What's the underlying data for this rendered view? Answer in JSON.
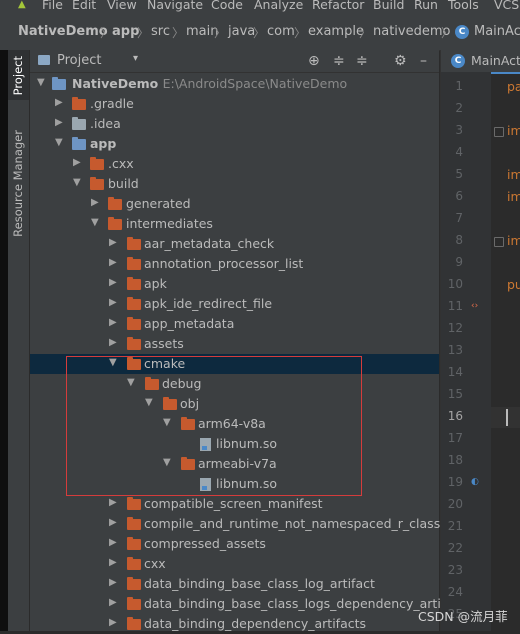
{
  "menu": [
    "File",
    "Edit",
    "View",
    "Navigate",
    "Code",
    "Analyze",
    "Refactor",
    "Build",
    "Run",
    "Tools",
    "VCS"
  ],
  "breadcrumb": [
    "NativeDemo",
    "app",
    "src",
    "main",
    "java",
    "com",
    "example",
    "nativedemo",
    "MainActi"
  ],
  "sidebar": {
    "project_tab": "Project",
    "resource_tab": "Resource Manager"
  },
  "panel": {
    "title": "Project"
  },
  "tree": [
    {
      "label": "NativeDemo",
      "path": "E:\\AndroidSpace\\NativeDemo"
    },
    {
      "label": ".gradle"
    },
    {
      "label": ".idea"
    },
    {
      "label": "app"
    },
    {
      "label": ".cxx"
    },
    {
      "label": "build"
    },
    {
      "label": "generated"
    },
    {
      "label": "intermediates"
    },
    {
      "label": "aar_metadata_check"
    },
    {
      "label": "annotation_processor_list"
    },
    {
      "label": "apk"
    },
    {
      "label": "apk_ide_redirect_file"
    },
    {
      "label": "app_metadata"
    },
    {
      "label": "assets"
    },
    {
      "label": "cmake"
    },
    {
      "label": "debug"
    },
    {
      "label": "obj"
    },
    {
      "label": "arm64-v8a"
    },
    {
      "label": "libnum.so"
    },
    {
      "label": "armeabi-v7a"
    },
    {
      "label": "libnum.so"
    },
    {
      "label": "compatible_screen_manifest"
    },
    {
      "label": "compile_and_runtime_not_namespaced_r_class_jar"
    },
    {
      "label": "compressed_assets"
    },
    {
      "label": "cxx"
    },
    {
      "label": "data_binding_base_class_log_artifact"
    },
    {
      "label": "data_binding_base_class_logs_dependency_artifacts"
    },
    {
      "label": "data_binding_dependency_artifacts"
    }
  ],
  "editor": {
    "tab": "MainActi",
    "line_numbers": [
      "1",
      "2",
      "3",
      "4",
      "5",
      "6",
      "7",
      "8",
      "9",
      "10",
      "11",
      "12",
      "13",
      "14",
      "15",
      "16",
      "17",
      "18",
      "19",
      "20",
      "21",
      "22",
      "23",
      "24",
      "25"
    ],
    "current_line": "16",
    "code": [
      {
        "line": 1,
        "text": "pa"
      },
      {
        "line": 3,
        "text": "im"
      },
      {
        "line": 5,
        "text": "im"
      },
      {
        "line": 6,
        "text": "im"
      },
      {
        "line": 8,
        "text": "im"
      },
      {
        "line": 10,
        "text": "pu"
      }
    ]
  },
  "watermark": "CSDN @流月菲",
  "colors": {
    "background": "#2b2b2b",
    "panel": "#3c3f41",
    "selection": "#0d293e",
    "folder": "#c65a2e",
    "highlight_box": "#d53c3c",
    "accent": "#4a88c7"
  }
}
